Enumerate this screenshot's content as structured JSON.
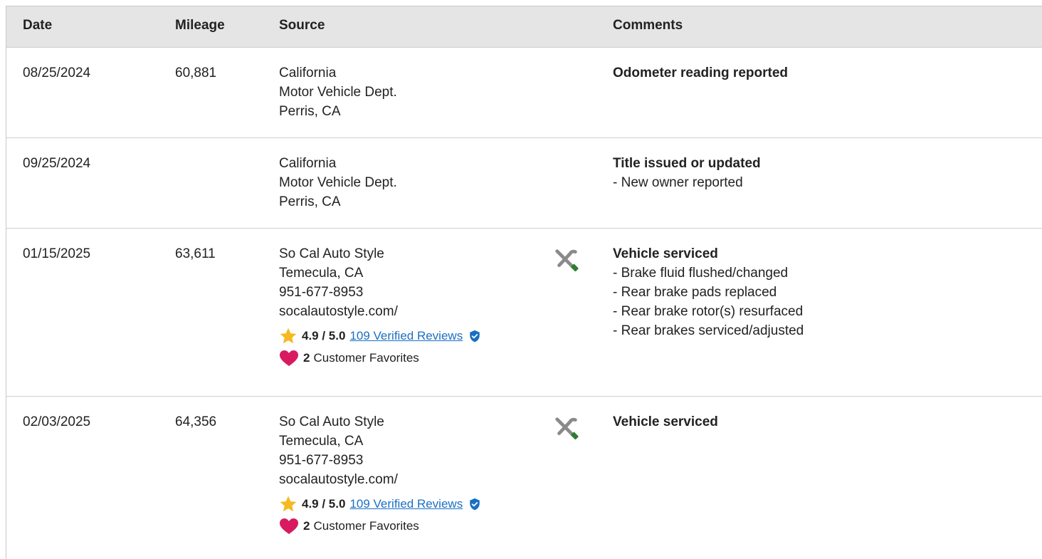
{
  "header": {
    "date": "Date",
    "mileage": "Mileage",
    "source": "Source",
    "comments": "Comments"
  },
  "rows": [
    {
      "date": "08/25/2024",
      "mileage": "60,881",
      "source": [
        "California",
        "Motor Vehicle Dept.",
        "Perris, CA"
      ],
      "comment_title": "Odometer reading reported",
      "comment_items": []
    },
    {
      "date": "09/25/2024",
      "mileage": "",
      "source": [
        "California",
        "Motor Vehicle Dept.",
        "Perris, CA"
      ],
      "comment_title": "Title issued or updated",
      "comment_items": [
        "- New owner reported"
      ]
    },
    {
      "date": "01/15/2025",
      "mileage": "63,611",
      "source": [
        "So Cal Auto Style",
        "Temecula, CA",
        "951-677-8953",
        "socalautostyle.com/"
      ],
      "rating": "4.9 / 5.0",
      "reviews_link": "109 Verified Reviews",
      "favorites_count": "2",
      "favorites_label": "Customer Favorites",
      "service_icon": "wrench-screwdriver-icon",
      "comment_title": "Vehicle serviced",
      "comment_items": [
        "- Brake fluid flushed/changed",
        "- Rear brake pads replaced",
        "- Rear brake rotor(s) resurfaced",
        "- Rear brakes serviced/adjusted"
      ]
    },
    {
      "date": "02/03/2025",
      "mileage": "64,356",
      "source": [
        "So Cal Auto Style",
        "Temecula, CA",
        "951-677-8953",
        "socalautostyle.com/"
      ],
      "rating": "4.9 / 5.0",
      "reviews_link": "109 Verified Reviews",
      "favorites_count": "2",
      "favorites_label": "Customer Favorites",
      "service_icon": "wrench-screwdriver-icon",
      "comment_title": "Vehicle serviced",
      "comment_items": []
    }
  ],
  "colors": {
    "header_bg": "#e5e5e5",
    "link": "#1a6fc4",
    "star": "#f5b921",
    "heart": "#d81b60",
    "verified": "#1a6fc4",
    "tool_gray": "#8a8a8a",
    "tool_green": "#2e7d32"
  }
}
